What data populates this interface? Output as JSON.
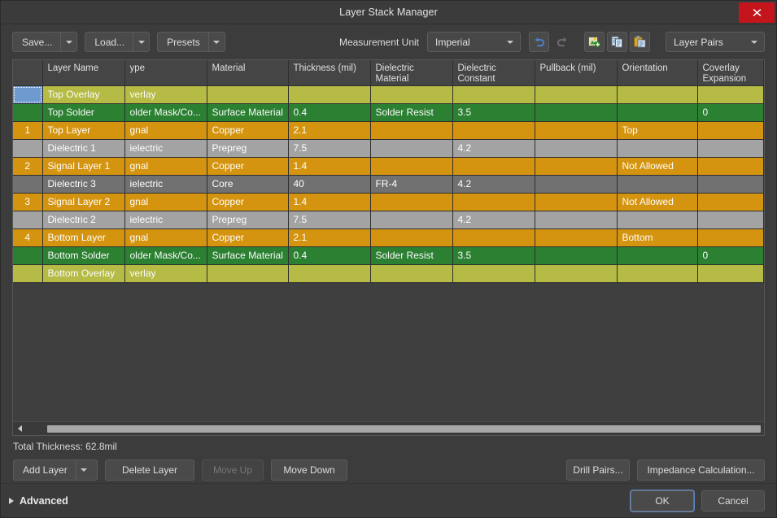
{
  "window": {
    "title": "Layer Stack Manager",
    "close_label": "close-icon"
  },
  "toolbar": {
    "save_label": "Save...",
    "load_label": "Load...",
    "presets_label": "Presets",
    "measurement_unit_label": "Measurement Unit",
    "measurement_unit_value": "Imperial",
    "layer_pairs_value": "Layer Pairs",
    "icons": [
      "undo-icon",
      "redo-icon",
      "configure-layer-classes-icon",
      "copy-layer-stack-icon",
      "paste-layer-stack-icon"
    ]
  },
  "table": {
    "columns": [
      {
        "key": "num",
        "label": ""
      },
      {
        "key": "name",
        "label": "Layer Name"
      },
      {
        "key": "type",
        "label": "ype"
      },
      {
        "key": "material",
        "label": "Material"
      },
      {
        "key": "thickness",
        "label": "Thickness (mil)"
      },
      {
        "key": "dmaterial",
        "label": "Dielectric\nMaterial"
      },
      {
        "key": "dconstant",
        "label": "Dielectric\nConstant"
      },
      {
        "key": "pullback",
        "label": "Pullback (mil)"
      },
      {
        "key": "orient",
        "label": "Orientation"
      },
      {
        "key": "coverlay",
        "label": "Coverlay\nExpansion"
      }
    ],
    "rows": [
      {
        "num": "",
        "name": "Top Overlay",
        "type": "verlay",
        "material": "",
        "thickness": "",
        "dmaterial": "",
        "dconstant": "",
        "pullback": "",
        "orient": "",
        "coverlay": "",
        "style": "r-overlay",
        "selected": true
      },
      {
        "num": "",
        "name": "Top Solder",
        "type": "older Mask/Co...",
        "material": "Surface Material",
        "thickness": "0.4",
        "dmaterial": "Solder Resist",
        "dconstant": "3.5",
        "pullback": "",
        "orient": "",
        "coverlay": "0",
        "style": "r-solder",
        "selected": false
      },
      {
        "num": "1",
        "name": "Top Layer",
        "type": "gnal",
        "material": "Copper",
        "thickness": "2.1",
        "dmaterial": "",
        "dconstant": "",
        "pullback": "",
        "orient": "Top",
        "coverlay": "",
        "style": "r-signal",
        "selected": false
      },
      {
        "num": "",
        "name": "Dielectric 1",
        "type": "ielectric",
        "material": "Prepreg",
        "thickness": "7.5",
        "dmaterial": "",
        "dconstant": "4.2",
        "pullback": "",
        "orient": "",
        "coverlay": "",
        "style": "r-prepreg",
        "selected": false
      },
      {
        "num": "2",
        "name": "Signal Layer 1",
        "type": "gnal",
        "material": "Copper",
        "thickness": "1.4",
        "dmaterial": "",
        "dconstant": "",
        "pullback": "",
        "orient": "Not Allowed",
        "coverlay": "",
        "style": "r-signal",
        "selected": false
      },
      {
        "num": "",
        "name": "Dielectric 3",
        "type": "ielectric",
        "material": "Core",
        "thickness": "40",
        "dmaterial": "FR-4",
        "dconstant": "4.2",
        "pullback": "",
        "orient": "",
        "coverlay": "",
        "style": "r-core",
        "selected": false
      },
      {
        "num": "3",
        "name": "Signal Layer 2",
        "type": "gnal",
        "material": "Copper",
        "thickness": "1.4",
        "dmaterial": "",
        "dconstant": "",
        "pullback": "",
        "orient": "Not Allowed",
        "coverlay": "",
        "style": "r-signal",
        "selected": false
      },
      {
        "num": "",
        "name": "Dielectric 2",
        "type": "ielectric",
        "material": "Prepreg",
        "thickness": "7.5",
        "dmaterial": "",
        "dconstant": "4.2",
        "pullback": "",
        "orient": "",
        "coverlay": "",
        "style": "r-prepreg",
        "selected": false
      },
      {
        "num": "4",
        "name": "Bottom Layer",
        "type": "gnal",
        "material": "Copper",
        "thickness": "2.1",
        "dmaterial": "",
        "dconstant": "",
        "pullback": "",
        "orient": "Bottom",
        "coverlay": "",
        "style": "r-signal",
        "selected": false
      },
      {
        "num": "",
        "name": "Bottom Solder",
        "type": "older Mask/Co...",
        "material": "Surface Material",
        "thickness": "0.4",
        "dmaterial": "Solder Resist",
        "dconstant": "3.5",
        "pullback": "",
        "orient": "",
        "coverlay": "0",
        "style": "r-solder",
        "selected": false
      },
      {
        "num": "",
        "name": "Bottom Overlay",
        "type": "verlay",
        "material": "",
        "thickness": "",
        "dmaterial": "",
        "dconstant": "",
        "pullback": "",
        "orient": "",
        "coverlay": "",
        "style": "r-overlay",
        "selected": false
      }
    ]
  },
  "status": {
    "total_thickness": "Total Thickness: 62.8mil"
  },
  "actions": {
    "add_layer": "Add Layer",
    "delete_layer": "Delete Layer",
    "move_up": "Move Up",
    "move_down": "Move Down",
    "drill_pairs": "Drill Pairs...",
    "impedance": "Impedance Calculation..."
  },
  "footer": {
    "advanced": "Advanced",
    "ok": "OK",
    "cancel": "Cancel"
  },
  "colors": {
    "accent_blue": "#6f9ad0",
    "close_red": "#c4151c",
    "overlay": "#b5bb44",
    "solder": "#2b8032",
    "signal": "#d4940f",
    "prepreg": "#a3a3a3",
    "core": "#717171"
  }
}
